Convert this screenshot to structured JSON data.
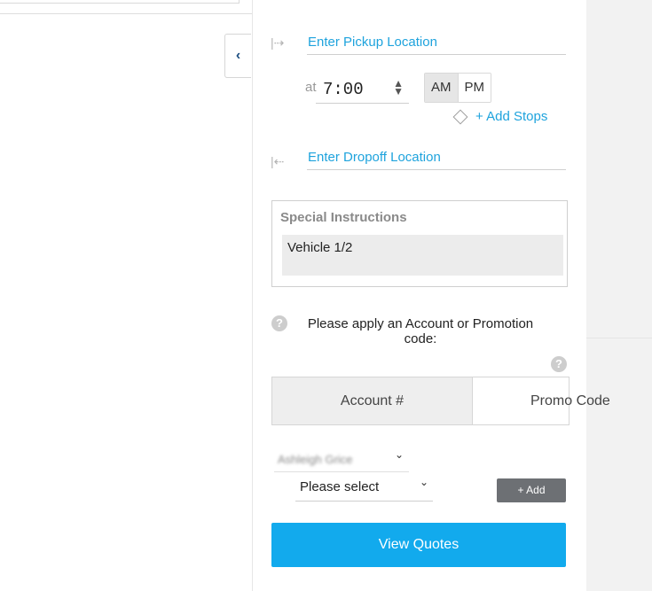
{
  "panel": {
    "collapse_icon": "chevron-left-icon",
    "collapse_glyph": "‹"
  },
  "pickup": {
    "icon": "pickup-arrow-icon",
    "icon_glyph": "|⇢",
    "placeholder": "Enter Pickup Location"
  },
  "time": {
    "at_label": "at",
    "value": "7:00",
    "spinner_glyph": "⬍",
    "am_label": "AM",
    "pm_label": "PM",
    "selected_period": "AM"
  },
  "stops": {
    "icon": "diamond-icon",
    "label": "+ Add Stops"
  },
  "dropoff": {
    "icon": "dropoff-arrow-icon",
    "icon_glyph": "|⇠",
    "placeholder": "Enter Dropoff Location"
  },
  "special_instructions": {
    "title": "Special Instructions",
    "value": "Vehicle 1/2"
  },
  "code_prompt": {
    "help_glyph": "?",
    "text_line1": "Please apply an Account or Promotion",
    "text_line2": "code:"
  },
  "tabs": [
    {
      "label": "Account #",
      "active": true
    },
    {
      "label": "Promo Code",
      "active": false
    }
  ],
  "account_select": {
    "value": "Ashleigh Grice",
    "chevron": "⌄"
  },
  "vehicle_select": {
    "value": "Please select",
    "chevron": "⌄"
  },
  "add_button": {
    "label": "+ Add"
  },
  "quotes_button": {
    "label": "View Quotes"
  },
  "colors": {
    "accent": "#12aaed",
    "link": "#1ea3dd",
    "add_button": "#6d7074"
  }
}
